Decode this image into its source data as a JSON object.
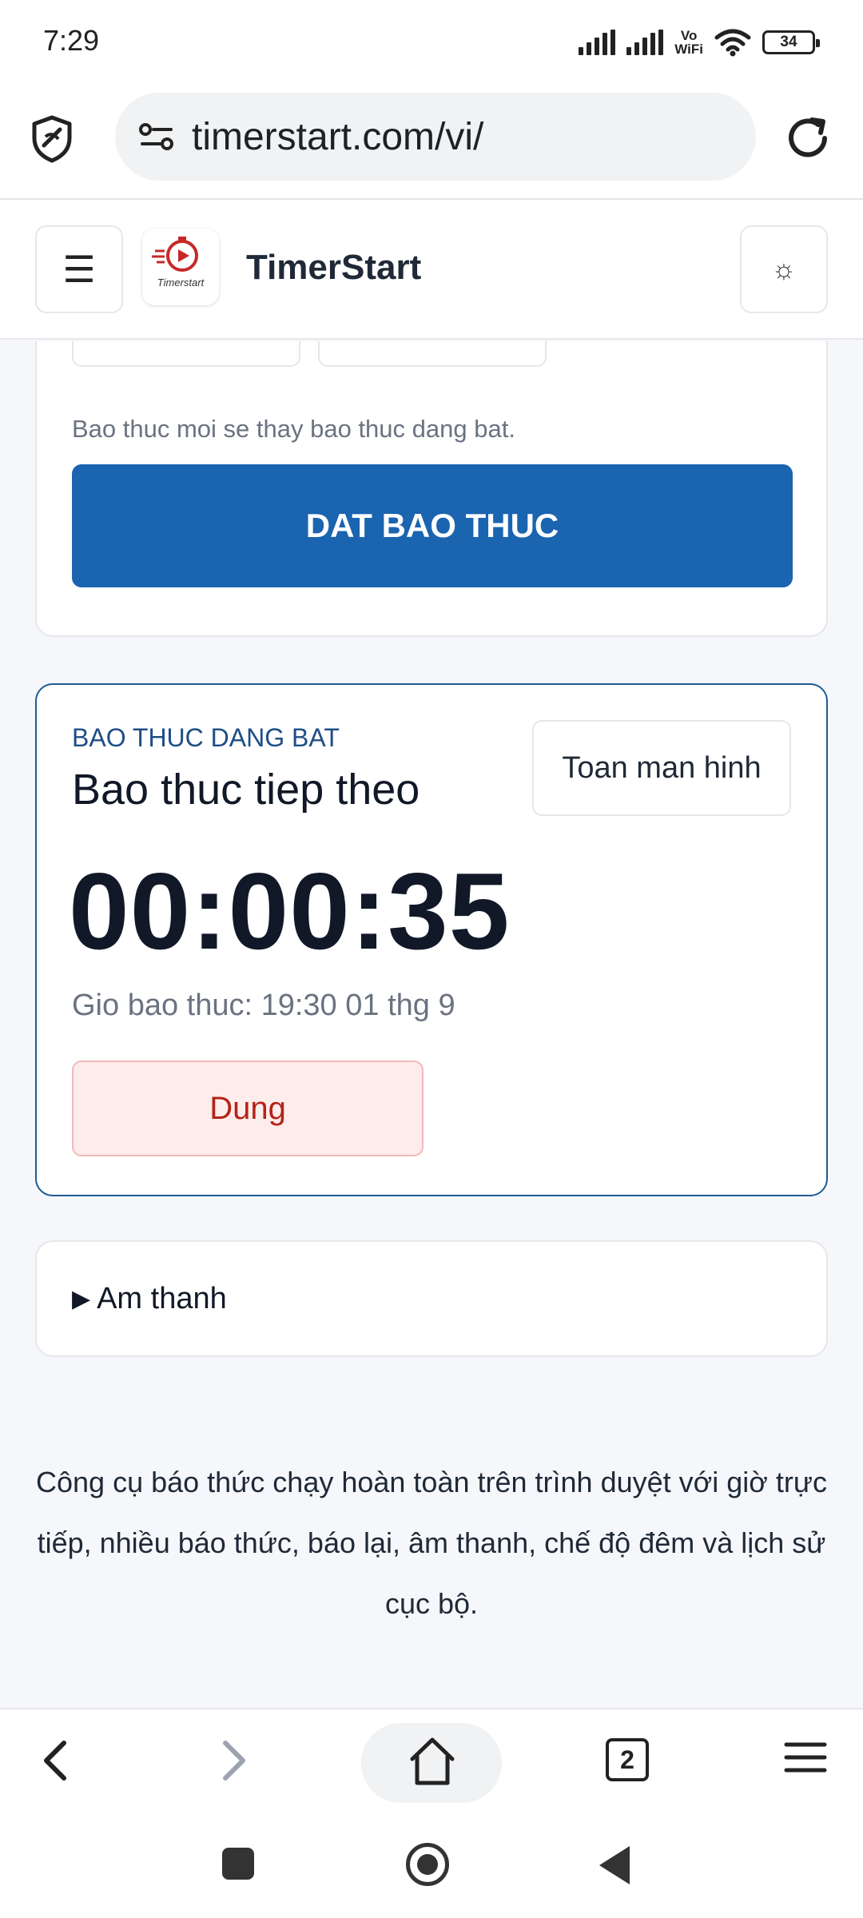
{
  "status_bar": {
    "time": "7:29",
    "vowifi_top": "Vo",
    "vowifi_bottom": "WiFi",
    "battery": "34"
  },
  "browser": {
    "url": "timerstart.com/vi/",
    "tabs_count": "2"
  },
  "site_header": {
    "logo_text": "Timerstart",
    "title": "TimerStart",
    "menu_glyph": "☰",
    "theme_glyph": "☼"
  },
  "set_alarm_card": {
    "note": "Bao thuc moi se thay bao thuc dang bat.",
    "set_button_label": "DAT BAO THUC"
  },
  "active_alarm_card": {
    "label": "BAO THUC DANG BAT",
    "title": "Bao thuc tiep theo",
    "fullscreen_label": "Toan man hinh",
    "countdown": "00:00:35",
    "alarm_time": "Gio bao thuc: 19:30 01 thg 9",
    "stop_label": "Dung"
  },
  "sound_section": {
    "triangle": "▶",
    "label": "Am thanh"
  },
  "footer": {
    "description": "Công cụ báo thức chạy hoàn toàn trên trình duyệt với giờ trực tiếp, nhiều báo thức, báo lại, âm thanh, chế độ đêm và lịch sử cục bộ."
  },
  "colors": {
    "primary": "#1a64b0",
    "active_border": "#1e5b93",
    "stop_bg": "#fdecec",
    "stop_text": "#b42318"
  }
}
